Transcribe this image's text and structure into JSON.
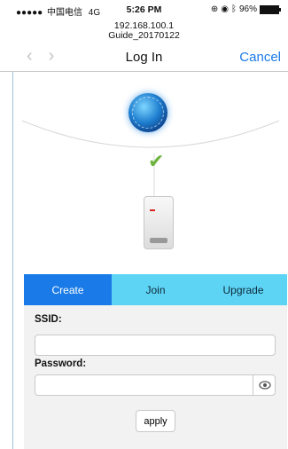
{
  "status_bar": {
    "signal": "●●●●●",
    "carrier": "中国电信",
    "network": "4G",
    "time": "5:26 PM",
    "battery": "96%"
  },
  "browser": {
    "url_line1": "192.168.100.1",
    "url_line2": "Guide_20170122",
    "title": "Log In",
    "cancel_label": "Cancel",
    "back_icon": "chevron-left-icon",
    "forward_icon": "chevron-right-icon"
  },
  "diagram": {
    "internet_icon": "globe-icon",
    "connection_status_icon": "checkmark-icon",
    "device_icon": "router-device-icon"
  },
  "tabs": [
    {
      "label": "Create",
      "active": true
    },
    {
      "label": "Join",
      "active": false
    },
    {
      "label": "Upgrade",
      "active": false
    }
  ],
  "form": {
    "ssid_label": "SSID:",
    "ssid_value": "",
    "password_label": "Password:",
    "password_value": "",
    "show_password_icon": "eye-icon",
    "apply_label": "apply"
  },
  "colors": {
    "accent": "#1a7be8",
    "tab_bar": "#5ed4f5",
    "check": "#6db33f",
    "form_bg": "#f2f2f2"
  }
}
